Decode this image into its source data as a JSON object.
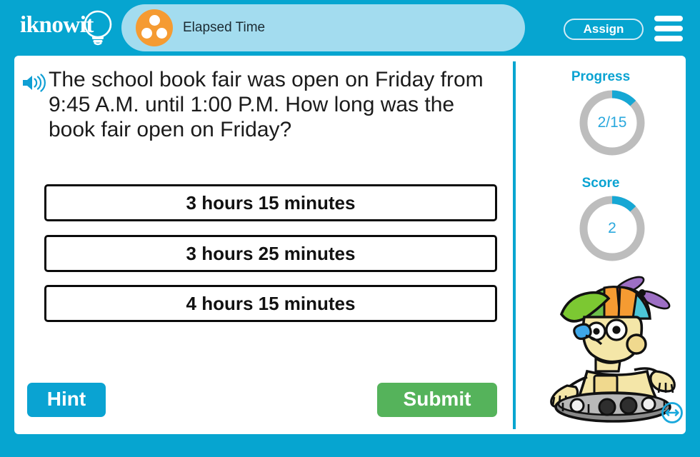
{
  "header": {
    "logo_text": "iknowit",
    "logo_icon": "lightbulb-icon",
    "tab_title": "Elapsed Time",
    "topic_icon": "three-dots-circle-icon",
    "assign_label": "Assign",
    "menu_icon": "hamburger-menu-icon"
  },
  "question": {
    "speaker_icon": "speaker-audio-icon",
    "text": "The school book fair was open on Friday from 9:45 A.M. until 1:00 P.M. How long was the book fair open on Friday?"
  },
  "answers": [
    {
      "label": "3 hours 15 minutes"
    },
    {
      "label": "3 hours 25 minutes"
    },
    {
      "label": "4 hours 15 minutes"
    }
  ],
  "actions": {
    "hint_label": "Hint",
    "submit_label": "Submit"
  },
  "sidebar": {
    "progress": {
      "label": "Progress",
      "value": "2/15",
      "current": 2,
      "total": 15,
      "percent": 13
    },
    "score": {
      "label": "Score",
      "value": "2",
      "percent": 13
    },
    "mascot_icon": "robot-mascot-propeller-hat",
    "resize_icon": "horizontal-resize-arrow-icon"
  },
  "colors": {
    "brand_blue": "#06a5d0",
    "tab_blue": "#a3dcef",
    "accent_orange": "#f59b32",
    "submit_green": "#55b35b",
    "ring_track_gray": "#bdbdbd",
    "ring_fill_blue": "#16a7d4",
    "answer_border": "#0b0b0b"
  }
}
